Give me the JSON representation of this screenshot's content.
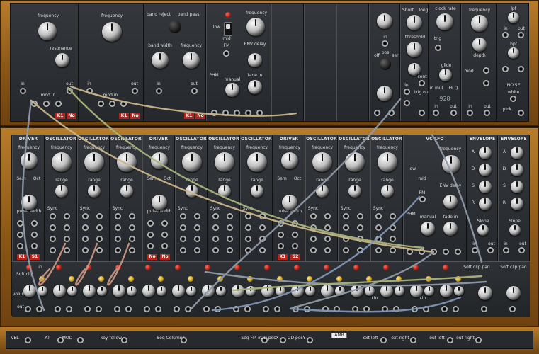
{
  "upper_rack": {
    "filter1": {
      "labels": [
        "frequency",
        "resonance",
        "in",
        "mod in",
        "out"
      ],
      "tabs": [
        "K1",
        "No"
      ]
    },
    "filter2": {
      "labels": [
        "frequency",
        "in",
        "mod in",
        "out"
      ],
      "tabs": [
        "K1",
        "No"
      ]
    },
    "bandfilter": {
      "labels": [
        "band reject",
        "band pass",
        "band width",
        "frequency",
        "in",
        "out"
      ],
      "tabs": [
        "K1",
        "No"
      ]
    },
    "lfo_small": {
      "labels": [
        "low",
        "mid",
        "FM",
        "frequency",
        "ENV delay",
        "fade in",
        "PHM",
        "manual"
      ]
    },
    "env_groups": {
      "labels": [
        "A",
        "D",
        "S",
        "R"
      ]
    },
    "sequencer": {
      "labels": [
        "off",
        "pos",
        "ser",
        "in",
        "out"
      ]
    },
    "sample_hold": {
      "labels": [
        "Short",
        "long",
        "threshold",
        "cont",
        "trig out",
        "in",
        "out"
      ]
    },
    "clock": {
      "labels": [
        "clock rate",
        "trig",
        "glide",
        "in mul",
        "Hi Q",
        "928",
        "in",
        "out"
      ]
    },
    "mod_block": {
      "labels": [
        "frequency",
        "depth",
        "mod",
        "in",
        "out"
      ]
    },
    "filters_right": {
      "labels": [
        "lpf",
        "hpf",
        "NOISE",
        "white",
        "pink",
        "in",
        "out"
      ]
    }
  },
  "lower_rack": {
    "modules": [
      {
        "title": "DRIVER",
        "labels": [
          "frequency",
          "Sem",
          "Oct",
          "pulse width",
          "K1",
          "S1"
        ]
      },
      {
        "title": "OSCILLATOR",
        "labels": [
          "frequency",
          "range",
          "Sync"
        ]
      },
      {
        "title": "OSCILLATOR",
        "labels": [
          "frequency",
          "range",
          "Sync"
        ]
      },
      {
        "title": "OSCILLATOR",
        "labels": [
          "frequency",
          "range",
          "Sync"
        ]
      },
      {
        "title": "DRIVER",
        "labels": [
          "frequency",
          "Sem",
          "Oct",
          "pulse width",
          "No",
          "No"
        ]
      },
      {
        "title": "OSCILLATOR",
        "labels": [
          "frequency",
          "range",
          "Sync"
        ]
      },
      {
        "title": "OSCILLATOR",
        "labels": [
          "frequency",
          "range",
          "Sync"
        ]
      },
      {
        "title": "OSCILLATOR",
        "labels": [
          "frequency",
          "range",
          "Sync"
        ]
      },
      {
        "title": "DRIVER",
        "labels": [
          "frequency",
          "Sem",
          "Oct",
          "pulse width",
          "K1",
          "S2"
        ]
      },
      {
        "title": "OSCILLATOR",
        "labels": [
          "frequency",
          "range",
          "Sync"
        ]
      },
      {
        "title": "OSCILLATOR",
        "labels": [
          "frequency",
          "range",
          "Sync"
        ]
      },
      {
        "title": "OSCILLATOR",
        "labels": [
          "frequency",
          "range",
          "Sync"
        ]
      },
      {
        "title": "VC LFO",
        "labels": [
          "frequency",
          "low",
          "mid",
          "FM",
          "ENV delay",
          "fade in",
          "PHM",
          "manual"
        ]
      },
      {
        "title": "ENVELOPE",
        "labels": [
          "A",
          "D",
          "S",
          "R",
          "Slope",
          "in",
          "out"
        ]
      },
      {
        "title": "ENVELOPE",
        "labels": [
          "A",
          "D",
          "S",
          "R",
          "Slope",
          "in",
          "out"
        ]
      }
    ],
    "mixer_labels": {
      "soft_clip": "Soft clip",
      "in": "in",
      "volume": "volume",
      "out": "out",
      "lin": "Lin",
      "soft_clip_pan": "Soft clip pan"
    }
  },
  "bottom_bar": {
    "labels": [
      "VEL",
      "AT",
      "MOD",
      "key follow",
      "Seq Columns",
      "Seq FM in",
      "2D posX",
      "2D posY",
      "AMB",
      "ext left",
      "ext right",
      "out left",
      "out right"
    ]
  },
  "cable_colors": {
    "grey": "#8f9aa6",
    "beige": "#c9b58b",
    "pink": "#c79583",
    "green": "#a8b27a",
    "blue": "#7f95b5"
  }
}
